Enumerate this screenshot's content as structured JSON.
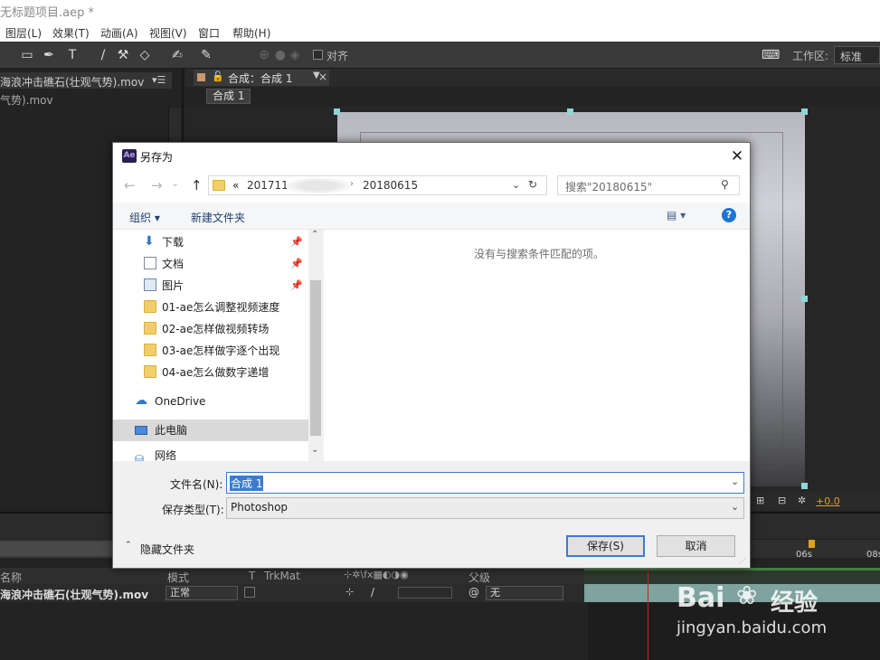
{
  "app": {
    "window_title": "无标题项目.aep *",
    "menu": [
      "图层(L)",
      "效果(T)",
      "动画(A)",
      "视图(V)",
      "窗口",
      "帮助(H)"
    ],
    "toolbar": {
      "align_label": "对齐",
      "workspace_label": "工作区:",
      "workspace_value": "标准"
    }
  },
  "project": {
    "tab_label": "海浪冲击礁石(壮观气势).mov",
    "sub_label": "气势).mov"
  },
  "comp": {
    "tab_label": "合成：合成 1",
    "breadcrumb": "合成 1",
    "exposure": "+0.0"
  },
  "timeline": {
    "ruler_labels": [
      "06s",
      "08s"
    ],
    "columns": {
      "name": "名称",
      "mode": "模式",
      "t": "T",
      "trkmat": "TrkMat",
      "parent": "父级"
    },
    "layer": {
      "name": "海浪冲击礁石(壮观气势).mov",
      "mode": "正常",
      "parent": "无"
    }
  },
  "dialog": {
    "title": "另存为",
    "address": {
      "prefix": "«",
      "crumb1": "201711",
      "crumb2": "20180615"
    },
    "search_placeholder": "搜索\"20180615\"",
    "organize_label": "组织 ▾",
    "new_folder_label": "新建文件夹",
    "nav_items": [
      {
        "label": "下载",
        "icon": "download-icon",
        "pinned": true
      },
      {
        "label": "文档",
        "icon": "document-icon",
        "pinned": true
      },
      {
        "label": "图片",
        "icon": "picture-icon",
        "pinned": true
      },
      {
        "label": "01-ae怎么调整视频速度",
        "icon": "folder-icon",
        "pinned": false
      },
      {
        "label": "02-ae怎样做视频转场",
        "icon": "folder-icon",
        "pinned": false
      },
      {
        "label": "03-ae怎样做字逐个出现",
        "icon": "folder-icon",
        "pinned": false
      },
      {
        "label": "04-ae怎么做数字递增",
        "icon": "folder-icon",
        "pinned": false
      },
      {
        "label": "OneDrive",
        "icon": "cloud-icon",
        "pinned": false
      },
      {
        "label": "此电脑",
        "icon": "computer-icon",
        "pinned": false
      },
      {
        "label": "网络",
        "icon": "network-icon",
        "pinned": false
      }
    ],
    "empty_message": "没有与搜索条件匹配的项。",
    "filename_label": "文件名(N):",
    "filename_value": "合成 1",
    "filetype_label": "保存类型(T):",
    "filetype_value": "Photoshop",
    "hide_folders_label": "隐藏文件夹",
    "save_label": "保存(S)",
    "cancel_label": "取消"
  },
  "watermark": {
    "brand": "Bai",
    "brand2": "经验",
    "url": "jingyan.baidu.com"
  }
}
